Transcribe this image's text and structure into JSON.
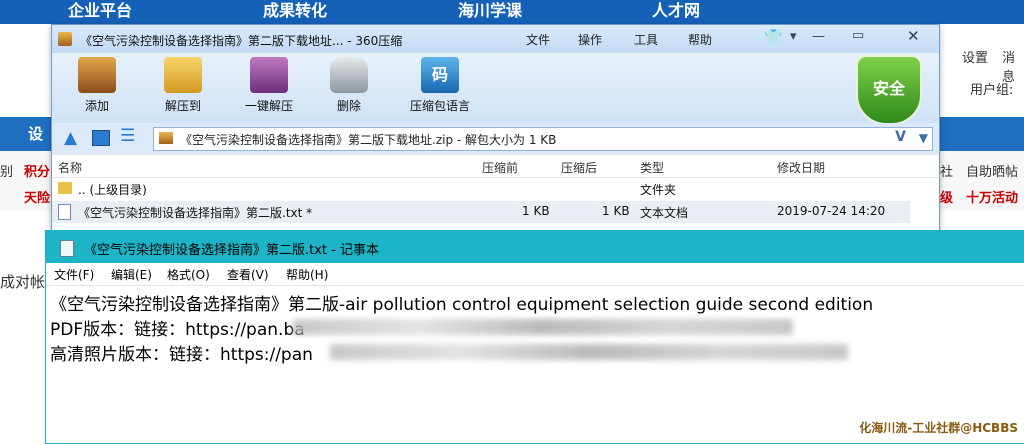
{
  "site": {
    "nav": [
      "企业平台",
      "成果转化",
      "海川学课",
      "人才网"
    ],
    "header_right": [
      "设置",
      "消息"
    ],
    "user_group_label": "用户组:",
    "bar_label": "设",
    "left_side": [
      "别",
      "积分",
      "天险"
    ],
    "sub_right": [
      "社",
      "自助晒帖"
    ],
    "sub_right2": [
      "级",
      "十万活动"
    ],
    "left_bottom": "成对帐号"
  },
  "zip_window": {
    "title": "《空气污染控制设备选择指南》第二版下载地址... - 360压缩",
    "menu": [
      "文件",
      "操作",
      "工具",
      "帮助"
    ],
    "toolbar": [
      {
        "label": "添加",
        "icon": "add-archive-icon",
        "color": "#c98a2b"
      },
      {
        "label": "解压到",
        "icon": "extract-to-icon",
        "color": "#e2b23a"
      },
      {
        "label": "一键解压",
        "icon": "one-click-extract-icon",
        "color": "#9a4a9c"
      },
      {
        "label": "删除",
        "icon": "trash-bin-icon",
        "color": "#9aa3ab"
      },
      {
        "label": "压缩包语言",
        "icon": "archive-language-icon",
        "color": "#2a83c8"
      }
    ],
    "security_badge": "安全",
    "address": "《空气污染控制设备选择指南》第二版下载地址.zip - 解包大小为 1 KB",
    "columns": [
      "名称",
      "压缩前",
      "压缩后",
      "类型",
      "修改日期"
    ],
    "rows": [
      {
        "name": ".. (上级目录)",
        "before": "",
        "after": "",
        "type": "文件夹",
        "date": ""
      },
      {
        "name": "《空气污染控制设备选择指南》第二版.txt *",
        "before": "1 KB",
        "after": "1 KB",
        "type": "文本文档",
        "date": "2019-07-24 14:20"
      }
    ]
  },
  "notepad": {
    "title": "《空气污染控制设备选择指南》第二版.txt - 记事本",
    "menu": [
      "文件(F)",
      "编辑(E)",
      "格式(O)",
      "查看(V)",
      "帮助(H)"
    ],
    "lines": [
      "《空气污染控制设备选择指南》第二版-air pollution control equipment selection guide second edition",
      "PDF版本：链接：https://pan.ba",
      "高清照片版本：链接：https://pan"
    ]
  },
  "watermark": "化海川流-工业社群@HCBBS"
}
